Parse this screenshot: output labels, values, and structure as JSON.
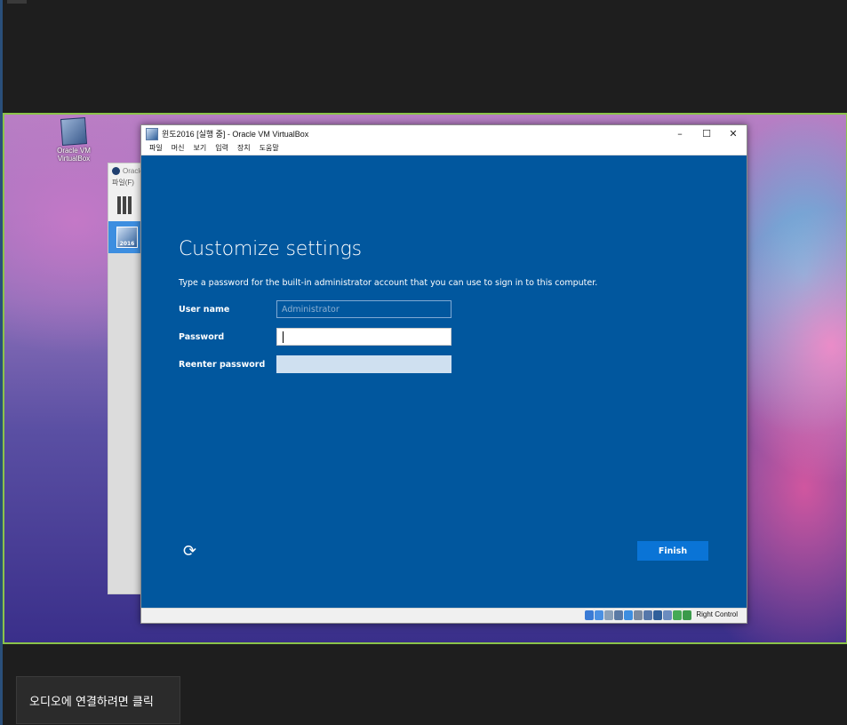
{
  "desktop": {
    "icon_label": "Oracle VM VirtualBox",
    "manager_title": "Oracle",
    "manager_menu": "파일(F)",
    "manager_vm_badge": "2016"
  },
  "vbox": {
    "title": "윈도2016 [실행 중] - Oracle VM VirtualBox",
    "menu": [
      "파일",
      "머신",
      "보기",
      "입력",
      "장치",
      "도움말"
    ],
    "minimize_glyph": "–",
    "maximize_glyph": "☐",
    "close_glyph": "✕",
    "status_icon_colors": [
      "#3a7bd5",
      "#4a90e2",
      "#8aa0b8",
      "#5a7aa5",
      "#3d8ee0",
      "#7a8aa0",
      "#5577aa",
      "#2f5f9a",
      "#6b8cbf",
      "#44aa55",
      "#3a9a4a"
    ],
    "host_key": "Right Control"
  },
  "guest": {
    "heading": "Customize settings",
    "description": "Type a password for the built-in administrator account that you can use to sign in to this computer.",
    "username_label": "User name",
    "username_placeholder": "Administrator",
    "password_label": "Password",
    "reenter_label": "Reenter password",
    "accessibility_glyph": "⟳",
    "finish_label": "Finish"
  },
  "call": {
    "audio_button": "오디오에 연결하려면 클릭"
  }
}
